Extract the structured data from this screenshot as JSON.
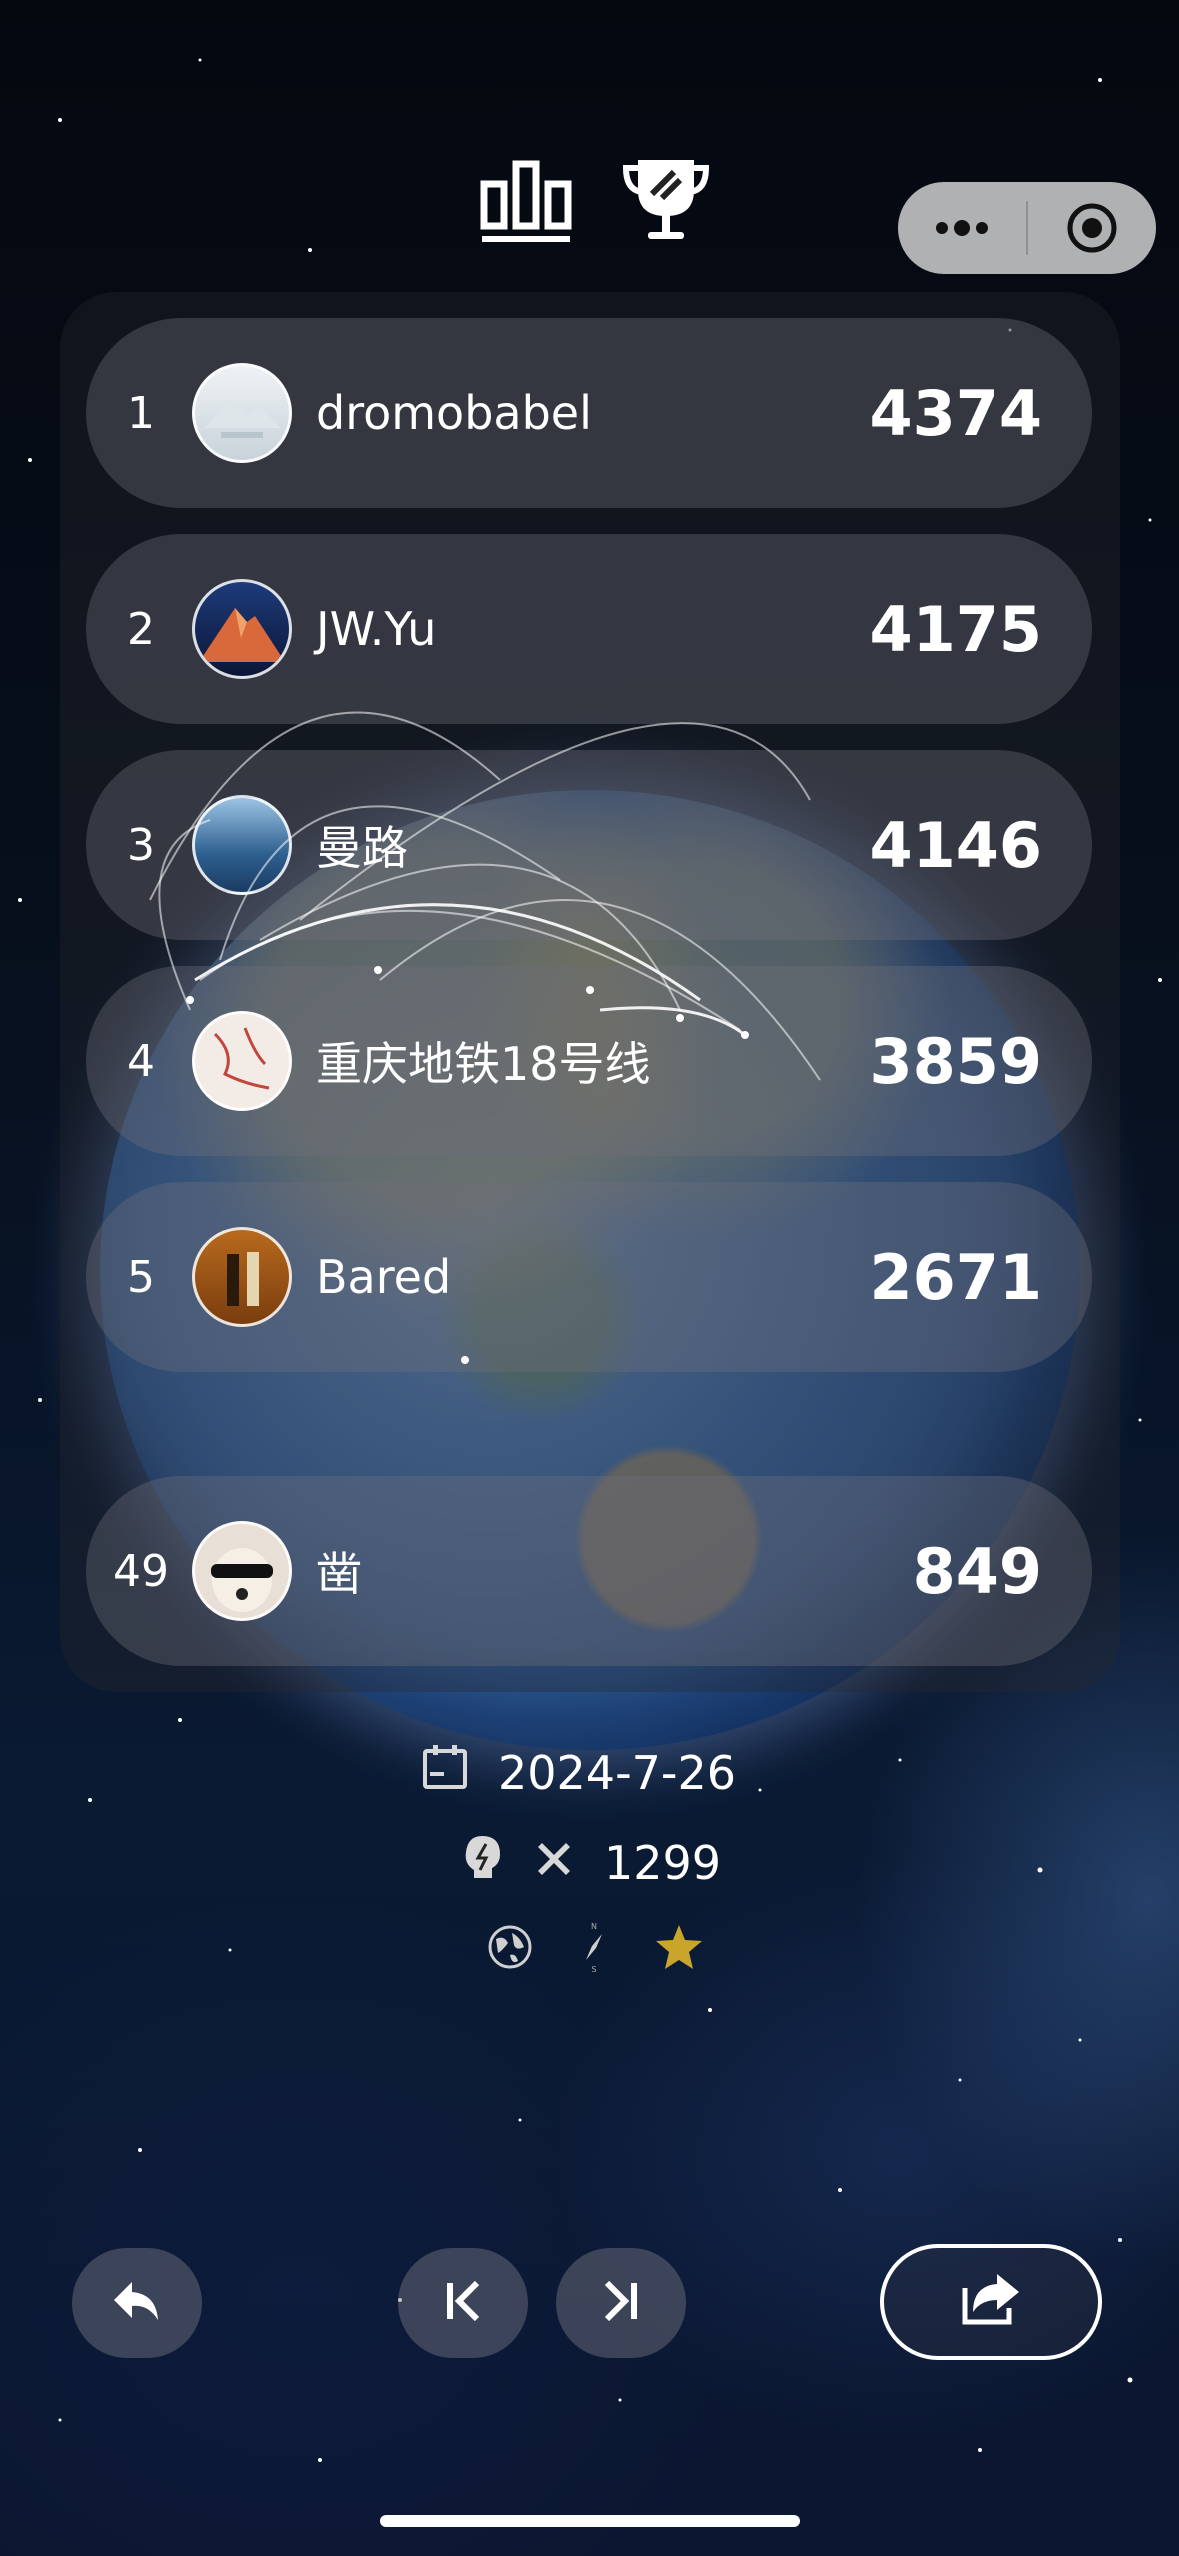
{
  "header": {
    "tabs": [
      {
        "icon": "bar-chart-icon"
      },
      {
        "icon": "trophy-icon"
      }
    ],
    "capsule": {
      "more_icon": "more-dots-icon",
      "close_icon": "target-icon"
    }
  },
  "leaderboard": {
    "rows": [
      {
        "rank": "1",
        "name": "dromobabel",
        "score": "4374"
      },
      {
        "rank": "2",
        "name": "JW.Yu",
        "score": "4175"
      },
      {
        "rank": "3",
        "name": "曼路",
        "score": "4146"
      },
      {
        "rank": "4",
        "name": "重庆地铁18号线",
        "score": "3859"
      },
      {
        "rank": "5",
        "name": "Bared",
        "score": "2671"
      }
    ],
    "self": {
      "rank": "49",
      "name": "凿",
      "score": "849"
    }
  },
  "info": {
    "date": "2024-7-26",
    "count": "1299",
    "icons": [
      "calendar-icon",
      "brain-icon",
      "cross-icon",
      "globe-icon",
      "compass-icon",
      "star-icon"
    ],
    "star_color": "#c9a52c"
  },
  "bottom_bar": {
    "buttons": [
      "back-icon",
      "first-icon",
      "last-icon",
      "share-icon"
    ]
  }
}
